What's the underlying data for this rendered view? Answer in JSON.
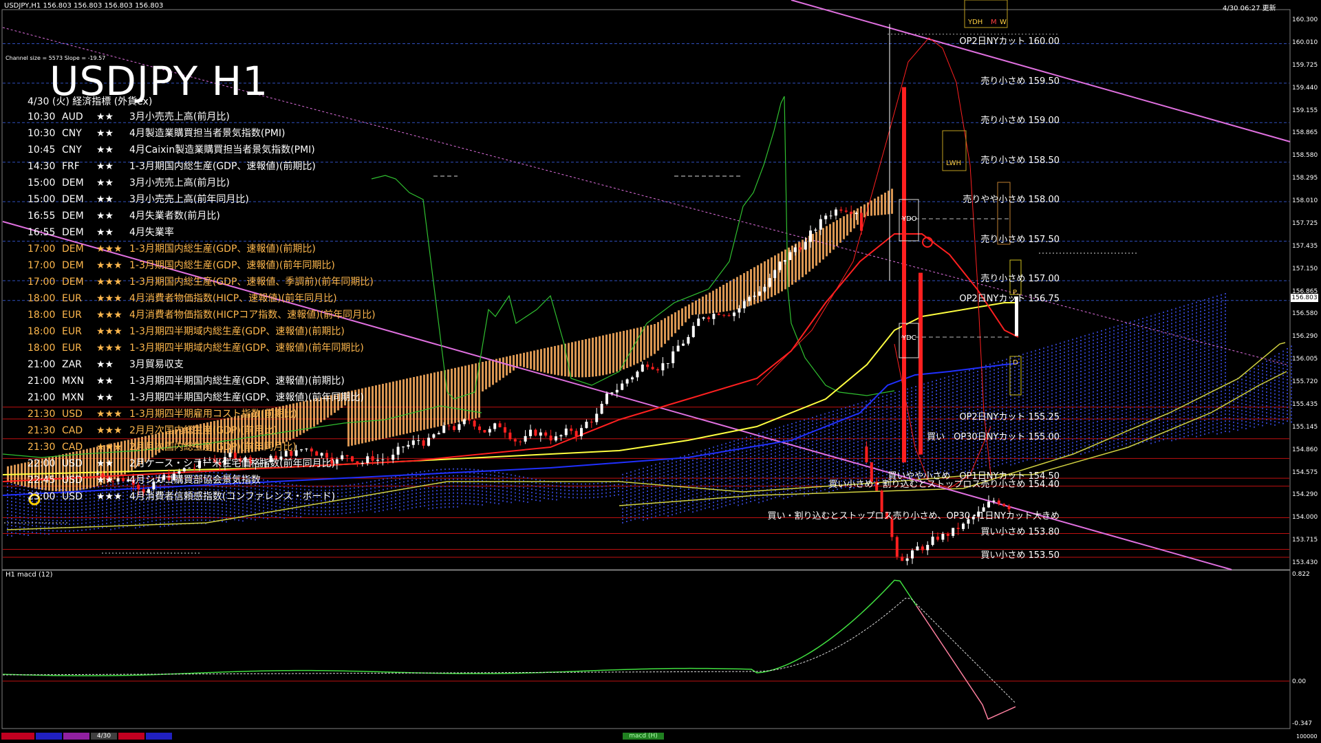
{
  "header": {
    "symbol_info": "USDJPY,H1  156.803 156.803 156.803 156.803",
    "timestamp": "4/30 06:27 更新",
    "channel_info": "Channel size = 5573 Slope = -19.57"
  },
  "title": "USDJPY H1",
  "events_subtitle": "4/30 (火) 経済指標 (外貨ex)",
  "events": [
    {
      "time": "10:30",
      "cur": "AUD",
      "stars": "★★",
      "text": "3月小売売上高(前月比)",
      "color": "#ffffff"
    },
    {
      "time": "10:30",
      "cur": "CNY",
      "stars": "★★",
      "text": "4月製造業購買担当者景気指数(PMI)",
      "color": "#ffffff"
    },
    {
      "time": "10:45",
      "cur": "CNY",
      "stars": "★★",
      "text": "4月Caixin製造業購買担当者景気指数(PMI)",
      "color": "#ffffff"
    },
    {
      "time": "14:30",
      "cur": "FRF",
      "stars": "★★",
      "text": "1-3月期国内総生産(GDP、速報値)(前期比)",
      "color": "#ffffff"
    },
    {
      "time": "15:00",
      "cur": "DEM",
      "stars": "★★",
      "text": "3月小売売上高(前月比)",
      "color": "#ffffff"
    },
    {
      "time": "15:00",
      "cur": "DEM",
      "stars": "★★",
      "text": "3月小売売上高(前年同月比)",
      "color": "#ffffff"
    },
    {
      "time": "16:55",
      "cur": "DEM",
      "stars": "★★",
      "text": "4月失業者数(前月比)",
      "color": "#ffffff"
    },
    {
      "time": "16:55",
      "cur": "DEM",
      "stars": "★★",
      "text": "4月失業率",
      "color": "#ffffff"
    },
    {
      "time": "17:00",
      "cur": "DEM",
      "stars": "★★★",
      "text": "1-3月期国内総生産(GDP、速報値)(前期比)",
      "color": "#ffb84d"
    },
    {
      "time": "17:00",
      "cur": "DEM",
      "stars": "★★★",
      "text": "1-3月期国内総生産(GDP、速報値)(前年同期比)",
      "color": "#ffb84d"
    },
    {
      "time": "17:00",
      "cur": "DEM",
      "stars": "★★★",
      "text": "1-3月期国内総生産(GDP、速報値、季調前)(前年同期比)",
      "color": "#ffb84d"
    },
    {
      "time": "18:00",
      "cur": "EUR",
      "stars": "★★★",
      "text": "4月消費者物価指数(HICP、速報値)(前年同月比)",
      "color": "#ffb84d"
    },
    {
      "time": "18:00",
      "cur": "EUR",
      "stars": "★★★",
      "text": "4月消費者物価指数(HICPコア指数、速報値)(前年同月比)",
      "color": "#ffb84d"
    },
    {
      "time": "18:00",
      "cur": "EUR",
      "stars": "★★★",
      "text": "1-3月期四半期域内総生産(GDP、速報値)(前期比)",
      "color": "#ffb84d"
    },
    {
      "time": "18:00",
      "cur": "EUR",
      "stars": "★★★",
      "text": "1-3月期四半期域内総生産(GDP、速報値)(前年同期比)",
      "color": "#ffb84d"
    },
    {
      "time": "21:00",
      "cur": "ZAR",
      "stars": "★★",
      "text": "3月貿易収支",
      "color": "#ffffff"
    },
    {
      "time": "21:00",
      "cur": "MXN",
      "stars": "★★",
      "text": "1-3月期四半期国内総生産(GDP、速報値)(前期比)",
      "color": "#ffffff"
    },
    {
      "time": "21:00",
      "cur": "MXN",
      "stars": "★★",
      "text": "1-3月期四半期国内総生産(GDP、速報値)(前年同期比)",
      "color": "#ffffff"
    },
    {
      "time": "21:30",
      "cur": "USD",
      "stars": "★★★",
      "text": "1-3月期四半期雇用コスト指数(前期比)",
      "color": "#ffb84d"
    },
    {
      "time": "21:30",
      "cur": "CAD",
      "stars": "★★★",
      "text": "2月月次国内総生産(GDP)(前月比)",
      "color": "#ffb84d"
    },
    {
      "time": "21:30",
      "cur": "CAD",
      "stars": "★★★",
      "text": "2月月次国内総生産(GDP)(前年同月比)",
      "color": "#ffb84d"
    },
    {
      "time": "22:00",
      "cur": "USD",
      "stars": "★★",
      "text": "2月ケース・シラー米住宅価格指数(前年同月比)",
      "color": "#ffffff"
    },
    {
      "time": "22:45",
      "cur": "USD",
      "stars": "★★",
      "text": "4月シカゴ購買部協会景気指数",
      "color": "#ffffff"
    },
    {
      "time": "23:00",
      "cur": "USD",
      "stars": "★★★",
      "text": "4月消費者信頼感指数(コンファレンス・ボード)",
      "color": "#ffffff"
    }
  ],
  "levels": [
    {
      "text": "OP2日NYカット 160.00",
      "price": 160.0
    },
    {
      "text": "売り小さめ 159.50",
      "price": 159.5
    },
    {
      "text": "売り小さめ 159.00",
      "price": 159.0
    },
    {
      "text": "売り小さめ 158.50",
      "price": 158.5
    },
    {
      "text": "売りやや小さめ 158.00",
      "price": 158.0
    },
    {
      "text": "売り小さめ 157.50",
      "price": 157.5
    },
    {
      "text": "売り小さめ 157.00",
      "price": 157.0
    },
    {
      "text": "OP2日NYカット 156.75",
      "price": 156.75
    },
    {
      "text": "OP2日NYカット 155.25",
      "price": 155.25
    },
    {
      "text": "買い　OP30日NYカット 155.00",
      "price": 155.0
    },
    {
      "text": "買いやや小さめ　OP1日NYカット 154.50",
      "price": 154.5
    },
    {
      "text": "買い小さめ・割り込むとストップロス売り小さめ 154.40",
      "price": 154.4
    },
    {
      "text": "買い・割り込むとストップロス売り小さめ、OP30・1日NYカット大きめ",
      "price": 154.0
    },
    {
      "text": "買い小さめ 153.80",
      "price": 153.8
    },
    {
      "text": "買い小さめ 153.50",
      "price": 153.5
    }
  ],
  "price_axis": [
    "160.300",
    "160.010",
    "159.725",
    "159.440",
    "159.155",
    "158.865",
    "158.580",
    "158.295",
    "158.010",
    "157.725",
    "157.435",
    "157.150",
    "156.865",
    "156.580",
    "156.290",
    "156.005",
    "155.720",
    "155.435",
    "155.145",
    "154.860",
    "154.575",
    "154.290",
    "154.000",
    "153.715",
    "153.430"
  ],
  "current_price": "156.803",
  "macd": {
    "label": "H1  macd (12)",
    "axis": [
      "0.822",
      "0.00",
      "-0.347"
    ]
  },
  "box_labels": {
    "ydh": "YDH",
    "m": "M",
    "w": "W",
    "lwh": "LWH",
    "ydo": "YDO",
    "ydc": "YDC",
    "p": "P",
    "d": "D"
  },
  "bottom": {
    "date_label": "4/30",
    "tab": "macd (H)",
    "right": "100000"
  },
  "colors": {
    "background": "#000000",
    "grid_blue": "#3050c0",
    "level_red": "#c01010",
    "channel": "#e070e0",
    "up_candle": "#ffffff",
    "down_candle": "#ff2020",
    "cloud_orange": "#ffb060",
    "cloud_blue": "#3040c0",
    "ma_yellow": "#ffff40",
    "ma_blue": "#2030ff",
    "macd_green": "#40e040",
    "macd_pink": "#ff80a0"
  }
}
